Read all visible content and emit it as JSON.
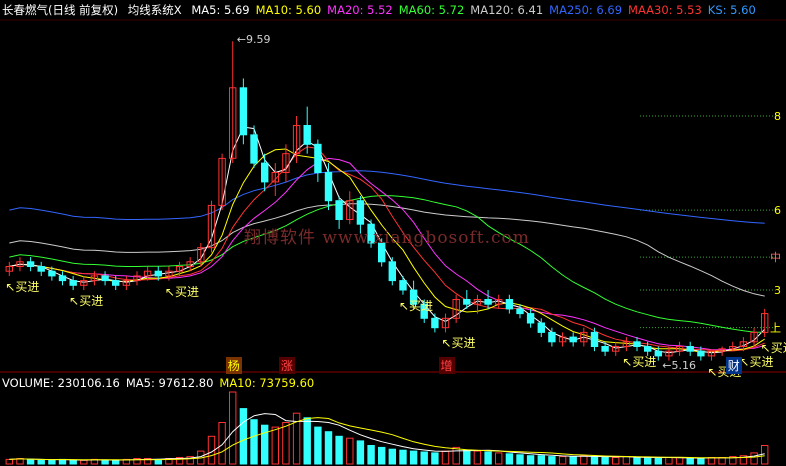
{
  "header": {
    "title": "长春燃气(日线 前复权)",
    "indicator": "均线系统X",
    "items": [
      {
        "label": "MA5:",
        "value": "5.69",
        "color": "#ffffff"
      },
      {
        "label": "MA10:",
        "value": "5.60",
        "color": "#ffff00"
      },
      {
        "label": "MA20:",
        "value": "5.52",
        "color": "#ff33ff"
      },
      {
        "label": "MA60:",
        "value": "5.72",
        "color": "#33ff33"
      },
      {
        "label": "MA120:",
        "value": "6.41",
        "color": "#cccccc"
      },
      {
        "label": "MA250:",
        "value": "6.69",
        "color": "#3366ff"
      },
      {
        "label": "MAA30:",
        "value": "5.53",
        "color": "#ff3333"
      },
      {
        "label": "KS:",
        "value": "5.60",
        "color": "#3399ff"
      }
    ]
  },
  "volume_header": {
    "items": [
      {
        "label": "VOLUME:",
        "value": "230106.16",
        "color": "#ffffff"
      },
      {
        "label": "MA5:",
        "value": "97612.80",
        "color": "#ffffff"
      },
      {
        "label": "MA10:",
        "value": "73759.60",
        "color": "#ffff00"
      }
    ]
  },
  "watermark": "翔博软件 www.xiangbosoft.com",
  "chart_data": {
    "type": "candlestick",
    "y_axis_ticks": [
      "8",
      "6",
      "中",
      "3",
      "上"
    ],
    "high_label": "9.59",
    "low_label": "5.16",
    "buy_label": "买进",
    "buy_signals": [
      0,
      6,
      15,
      37,
      41,
      58,
      66,
      69,
      71
    ],
    "event_labels": [
      {
        "text": "杨",
        "index": 21,
        "color": "#ffff00",
        "bg": "#7a3300"
      },
      {
        "text": "涨",
        "index": 26,
        "color": "#ff4444",
        "bg": "#550000"
      },
      {
        "text": "增",
        "index": 41,
        "color": "#ff4444",
        "bg": "#550000"
      },
      {
        "text": "财",
        "index": 68,
        "color": "#ffffff",
        "bg": "#003388"
      }
    ],
    "ohlc": [
      [
        4.7,
        4.9,
        4.6,
        4.8
      ],
      [
        4.8,
        5.0,
        4.7,
        4.9
      ],
      [
        4.9,
        5.0,
        4.7,
        4.8
      ],
      [
        4.8,
        4.9,
        4.6,
        4.7
      ],
      [
        4.7,
        4.8,
        4.5,
        4.6
      ],
      [
        4.6,
        4.7,
        4.4,
        4.5
      ],
      [
        4.5,
        4.6,
        4.3,
        4.4
      ],
      [
        4.4,
        4.6,
        4.3,
        4.5
      ],
      [
        4.5,
        4.7,
        4.4,
        4.6
      ],
      [
        4.6,
        4.7,
        4.4,
        4.5
      ],
      [
        4.5,
        4.6,
        4.3,
        4.4
      ],
      [
        4.4,
        4.6,
        4.3,
        4.5
      ],
      [
        4.5,
        4.7,
        4.4,
        4.6
      ],
      [
        4.6,
        4.8,
        4.5,
        4.7
      ],
      [
        4.7,
        4.8,
        4.5,
        4.6
      ],
      [
        4.6,
        4.8,
        4.5,
        4.7
      ],
      [
        4.7,
        4.9,
        4.6,
        4.8
      ],
      [
        4.8,
        5.0,
        4.7,
        4.9
      ],
      [
        4.9,
        5.3,
        4.8,
        5.2
      ],
      [
        5.2,
        6.2,
        5.1,
        6.1
      ],
      [
        6.1,
        7.2,
        6.0,
        7.1
      ],
      [
        7.1,
        9.59,
        7.0,
        8.6
      ],
      [
        8.6,
        8.8,
        7.4,
        7.6
      ],
      [
        7.6,
        7.8,
        6.9,
        7.0
      ],
      [
        7.0,
        7.2,
        6.4,
        6.6
      ],
      [
        6.6,
        7.0,
        6.3,
        6.8
      ],
      [
        6.8,
        7.4,
        6.6,
        7.2
      ],
      [
        7.2,
        8.0,
        7.0,
        7.8
      ],
      [
        7.8,
        8.2,
        7.2,
        7.4
      ],
      [
        7.4,
        7.5,
        6.6,
        6.8
      ],
      [
        6.8,
        7.0,
        6.0,
        6.2
      ],
      [
        6.2,
        6.3,
        5.6,
        5.8
      ],
      [
        5.8,
        6.4,
        5.7,
        6.2
      ],
      [
        6.2,
        6.3,
        5.5,
        5.7
      ],
      [
        5.7,
        5.8,
        5.2,
        5.3
      ],
      [
        5.3,
        5.4,
        4.8,
        4.9
      ],
      [
        4.9,
        5.0,
        4.4,
        4.5
      ],
      [
        4.5,
        4.6,
        4.2,
        4.3
      ],
      [
        4.3,
        4.5,
        3.9,
        4.0
      ],
      [
        4.0,
        4.1,
        3.6,
        3.7
      ],
      [
        3.7,
        3.8,
        3.4,
        3.5
      ],
      [
        3.5,
        3.8,
        3.4,
        3.7
      ],
      [
        3.7,
        4.2,
        3.6,
        4.1
      ],
      [
        4.1,
        4.3,
        3.9,
        4.0
      ],
      [
        4.0,
        4.2,
        3.8,
        4.1
      ],
      [
        4.1,
        4.3,
        3.9,
        4.0
      ],
      [
        4.0,
        4.2,
        3.9,
        4.1
      ],
      [
        4.1,
        4.2,
        3.8,
        3.9
      ],
      [
        3.9,
        4.0,
        3.7,
        3.8
      ],
      [
        3.8,
        3.9,
        3.5,
        3.6
      ],
      [
        3.6,
        3.7,
        3.3,
        3.4
      ],
      [
        3.4,
        3.5,
        3.1,
        3.2
      ],
      [
        3.2,
        3.4,
        3.1,
        3.3
      ],
      [
        3.3,
        3.4,
        3.1,
        3.2
      ],
      [
        3.2,
        3.5,
        3.1,
        3.4
      ],
      [
        3.4,
        3.5,
        3.0,
        3.1
      ],
      [
        3.1,
        3.2,
        2.9,
        3.0
      ],
      [
        3.0,
        3.2,
        2.9,
        3.1
      ],
      [
        3.1,
        3.3,
        3.0,
        3.2
      ],
      [
        3.2,
        3.3,
        3.0,
        3.1
      ],
      [
        3.1,
        3.2,
        2.9,
        3.0
      ],
      [
        3.0,
        3.1,
        2.8,
        2.9
      ],
      [
        2.9,
        3.1,
        2.8,
        3.0
      ],
      [
        3.0,
        3.2,
        2.9,
        3.1
      ],
      [
        3.1,
        3.2,
        2.9,
        3.0
      ],
      [
        3.0,
        3.1,
        2.8,
        2.9
      ],
      [
        2.9,
        3.0,
        2.8,
        3.0
      ],
      [
        3.0,
        3.1,
        2.9,
        3.05
      ],
      [
        3.05,
        3.2,
        3.0,
        3.1
      ],
      [
        3.1,
        3.3,
        3.0,
        3.2
      ],
      [
        3.2,
        3.5,
        3.1,
        3.4
      ],
      [
        3.4,
        3.9,
        3.3,
        3.8
      ]
    ],
    "volume": [
      5,
      6,
      5,
      4,
      4,
      5,
      4,
      4,
      5,
      4,
      4,
      5,
      6,
      6,
      5,
      6,
      7,
      8,
      14,
      30,
      45,
      78,
      60,
      48,
      42,
      40,
      45,
      55,
      50,
      40,
      35,
      30,
      28,
      25,
      20,
      18,
      16,
      15,
      14,
      13,
      12,
      14,
      18,
      15,
      14,
      13,
      12,
      11,
      10,
      9,
      9,
      8,
      8,
      8,
      9,
      8,
      7,
      7,
      8,
      7,
      7,
      6,
      7,
      7,
      6,
      6,
      7,
      7,
      8,
      9,
      12,
      20
    ]
  }
}
